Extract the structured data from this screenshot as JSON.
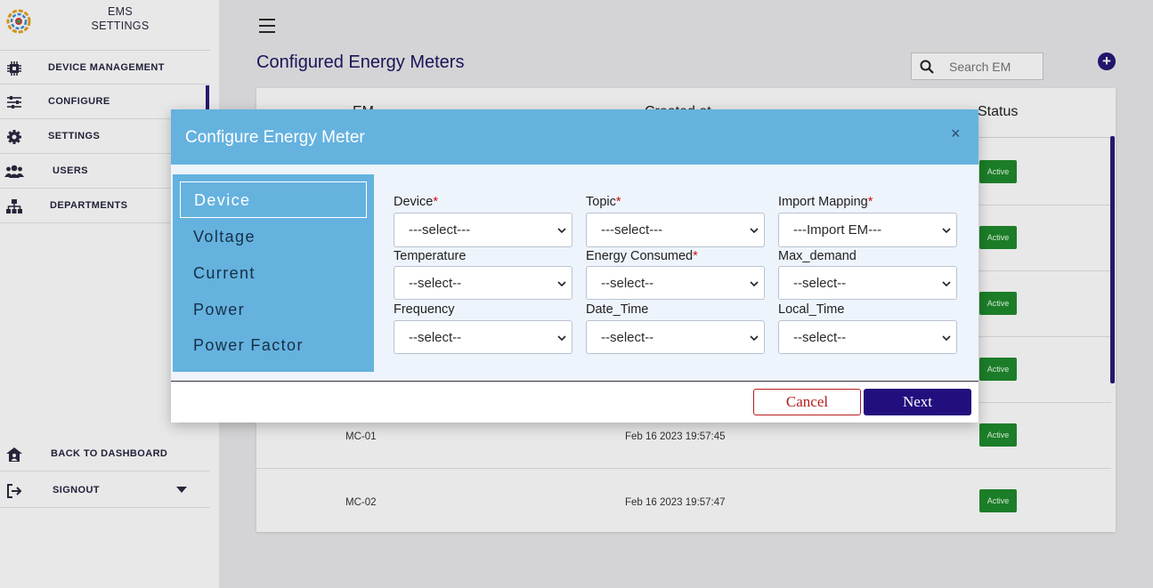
{
  "sidebar": {
    "brand_line1": "EMS",
    "brand_line2": "SETTINGS",
    "items": [
      {
        "label": "DEVICE MANAGEMENT",
        "icon": "chip-icon"
      },
      {
        "label": "CONFIGURE",
        "icon": "sliders-icon"
      },
      {
        "label": "SETTINGS",
        "icon": "gear-icon"
      },
      {
        "label": "USERS",
        "icon": "users-icon"
      },
      {
        "label": "DEPARTMENTS",
        "icon": "org-chart-icon"
      }
    ],
    "back_to_dashboard": "BACK TO DASHBOARD",
    "signout": "SIGNOUT"
  },
  "main": {
    "page_title": "Configured Energy Meters",
    "search_placeholder": "Search EM",
    "table": {
      "headers": [
        "EM",
        "Created at",
        "Status"
      ],
      "rows": [
        {
          "em": "",
          "created": "",
          "status": "Active"
        },
        {
          "em": "",
          "created": "",
          "status": "Active"
        },
        {
          "em": "",
          "created": "",
          "status": "Active"
        },
        {
          "em": "",
          "created": "",
          "status": "Active"
        },
        {
          "em": "MC-01",
          "created": "Feb 16 2023 19:57:45",
          "status": "Active"
        },
        {
          "em": "MC-02",
          "created": "Feb 16 2023 19:57:47",
          "status": "Active"
        }
      ]
    }
  },
  "modal": {
    "title": "Configure Energy Meter",
    "close": "×",
    "tabs": [
      "Device",
      "Voltage",
      "Current",
      "Power",
      "Power Factor"
    ],
    "fields": [
      {
        "label": "Device",
        "required": "*",
        "value": "---select---"
      },
      {
        "label": "Topic",
        "required": "*",
        "value": "---select---"
      },
      {
        "label": "Import Mapping",
        "required": "*",
        "value": "---Import EM---"
      },
      {
        "label": "Temperature",
        "required": "",
        "value": "--select--"
      },
      {
        "label": "Energy Consumed",
        "required": "*",
        "value": "--select--"
      },
      {
        "label": "Max_demand",
        "required": "",
        "value": "--select--"
      },
      {
        "label": "Frequency",
        "required": "",
        "value": "--select--"
      },
      {
        "label": "Date_Time",
        "required": "",
        "value": "--select--"
      },
      {
        "label": "Local_Time",
        "required": "",
        "value": "--select--"
      }
    ],
    "cancel_label": "Cancel",
    "next_label": "Next"
  },
  "colors": {
    "modal_header": "#65b2df",
    "primary": "#220f7d",
    "active_badge": "#1f8a2d",
    "required": "#cc1111"
  }
}
